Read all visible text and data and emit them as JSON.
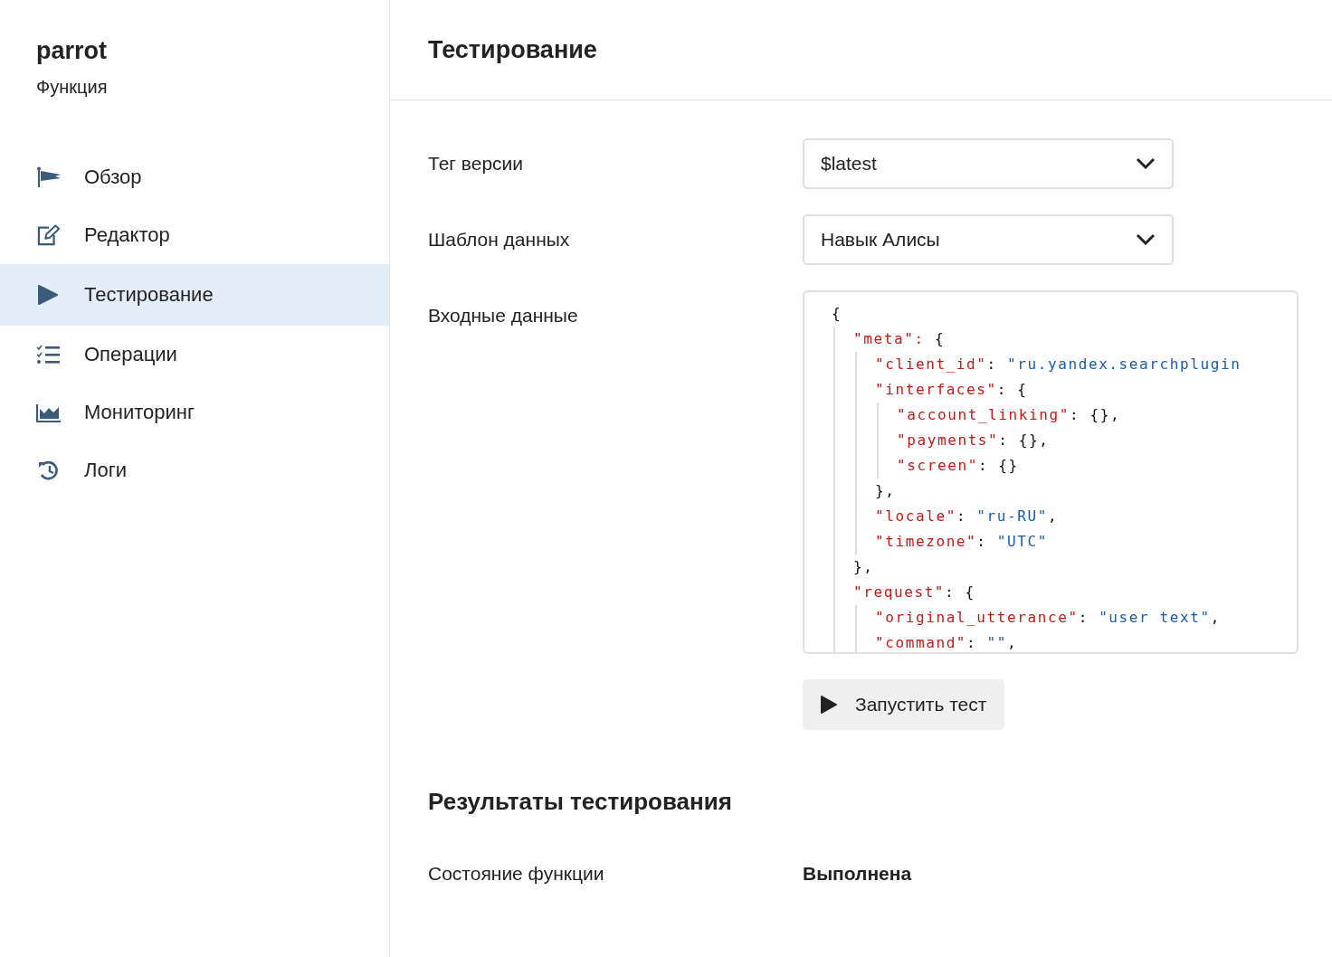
{
  "sidebar": {
    "title": "parrot",
    "subtitle": "Функция",
    "items": [
      {
        "label": "Обзор",
        "selected": false
      },
      {
        "label": "Редактор",
        "selected": false
      },
      {
        "label": "Тестирование",
        "selected": true
      },
      {
        "label": "Операции",
        "selected": false
      },
      {
        "label": "Мониторинг",
        "selected": false
      },
      {
        "label": "Логи",
        "selected": false
      }
    ]
  },
  "header": {
    "title": "Тестирование"
  },
  "form": {
    "version_tag": {
      "label": "Тег версии",
      "value": "$latest"
    },
    "data_template": {
      "label": "Шаблон данных",
      "value": "Навык Алисы"
    },
    "input_data": {
      "label": "Входные данные",
      "code": [
        {
          "tokens": [
            {
              "kind": "punct",
              "text": "{"
            }
          ],
          "children": [
            {
              "tokens": [
                {
                  "kind": "key",
                  "text": "\"meta\": "
                },
                {
                  "kind": "punct",
                  "text": "{"
                }
              ],
              "children": [
                {
                  "tokens": [
                    {
                      "kind": "key",
                      "text": "\"client_id\""
                    },
                    {
                      "kind": "punct",
                      "text": ": "
                    },
                    {
                      "kind": "string",
                      "text": "\"ru.yandex.searchplugin"
                    }
                  ]
                },
                {
                  "tokens": [
                    {
                      "kind": "key",
                      "text": "\"interfaces\""
                    },
                    {
                      "kind": "punct",
                      "text": ": {"
                    }
                  ],
                  "children": [
                    {
                      "tokens": [
                        {
                          "kind": "key",
                          "text": "\"account_linking\""
                        },
                        {
                          "kind": "punct",
                          "text": ": {},"
                        }
                      ]
                    },
                    {
                      "tokens": [
                        {
                          "kind": "key",
                          "text": "\"payments\""
                        },
                        {
                          "kind": "punct",
                          "text": ": {},"
                        }
                      ]
                    },
                    {
                      "tokens": [
                        {
                          "kind": "key",
                          "text": "\"screen\""
                        },
                        {
                          "kind": "punct",
                          "text": ": {}"
                        }
                      ]
                    }
                  ]
                },
                {
                  "tokens": [
                    {
                      "kind": "punct",
                      "text": "},"
                    }
                  ]
                },
                {
                  "tokens": [
                    {
                      "kind": "key",
                      "text": "\"locale\""
                    },
                    {
                      "kind": "punct",
                      "text": ": "
                    },
                    {
                      "kind": "string",
                      "text": "\"ru-RU\""
                    },
                    {
                      "kind": "punct",
                      "text": ","
                    }
                  ]
                },
                {
                  "tokens": [
                    {
                      "kind": "key",
                      "text": "\"timezone\""
                    },
                    {
                      "kind": "punct",
                      "text": ": "
                    },
                    {
                      "kind": "string",
                      "text": "\"UTC\""
                    }
                  ]
                }
              ]
            },
            {
              "tokens": [
                {
                  "kind": "punct",
                  "text": "},"
                }
              ]
            },
            {
              "tokens": [
                {
                  "kind": "key",
                  "text": "\"request\""
                },
                {
                  "kind": "punct",
                  "text": ": {"
                }
              ],
              "children": [
                {
                  "tokens": [
                    {
                      "kind": "key",
                      "text": "\"original_utterance\""
                    },
                    {
                      "kind": "punct",
                      "text": ": "
                    },
                    {
                      "kind": "string",
                      "text": "\"user text\""
                    },
                    {
                      "kind": "punct",
                      "text": ","
                    }
                  ]
                },
                {
                  "tokens": [
                    {
                      "kind": "key",
                      "text": "\"command\""
                    },
                    {
                      "kind": "punct",
                      "text": ": "
                    },
                    {
                      "kind": "string",
                      "text": "\"\""
                    },
                    {
                      "kind": "punct",
                      "text": ","
                    }
                  ]
                }
              ]
            }
          ]
        }
      ]
    },
    "run_button": "Запустить тест"
  },
  "results": {
    "title": "Результаты тестирования",
    "rows": [
      {
        "label": "Состояние функции",
        "value": "Выполнена"
      }
    ]
  }
}
